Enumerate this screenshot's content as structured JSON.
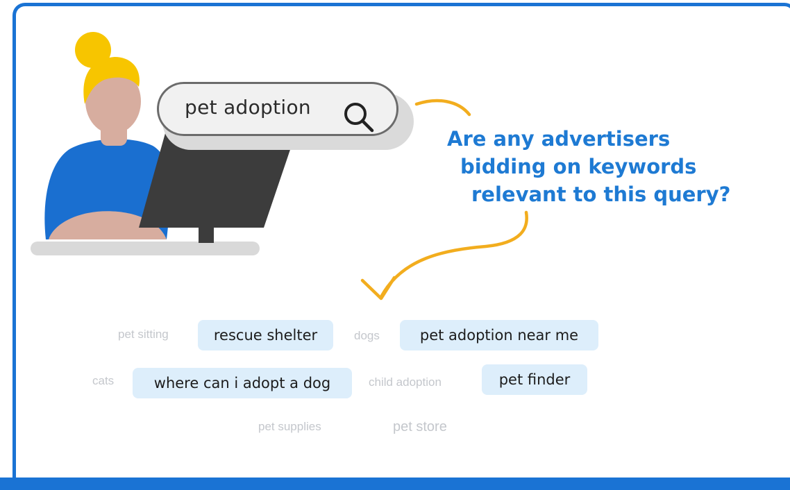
{
  "search": {
    "query": "pet adoption"
  },
  "question": {
    "lines": [
      "Are any advertisers",
      "bidding on keywords",
      "relevant to this query?"
    ]
  },
  "keywords": {
    "highlighted": [
      "rescue shelter",
      "pet adoption near me",
      "where can i adopt a dog",
      "pet finder"
    ],
    "faded": [
      "pet sitting",
      "dogs",
      "cats",
      "child adoption",
      "pet supplies",
      "pet store"
    ]
  },
  "colors": {
    "border": "#1a73d4",
    "question_text": "#1e7ad3",
    "arrow": "#f2ad1e",
    "chip_bg": "#ddeefb",
    "hair": "#f7c500",
    "shirt": "#1a6fd0",
    "monitor": "#3c3c3c"
  }
}
